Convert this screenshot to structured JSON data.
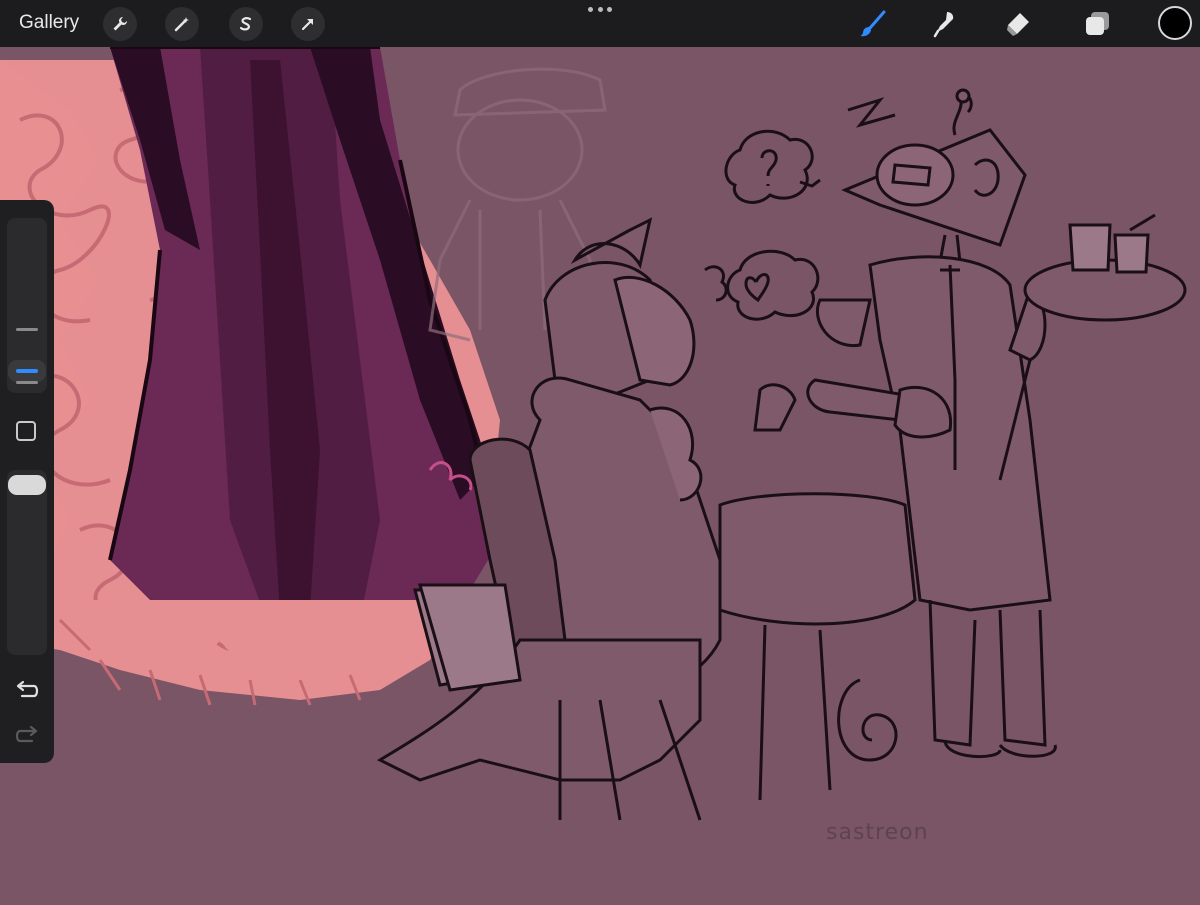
{
  "topbar": {
    "gallery_label": "Gallery",
    "left_tools": [
      "wrench-icon",
      "magic-wand-icon",
      "selection-icon",
      "transform-arrow-icon"
    ],
    "right_tools": [
      "brush-icon",
      "smudge-icon",
      "eraser-icon",
      "layers-icon"
    ],
    "color": "#000000"
  },
  "canvas": {
    "signature": "sastreon",
    "background": "#7a5566"
  },
  "sidebar": {
    "tools": [
      "brush-size-slider",
      "modify-button",
      "opacity-slider",
      "undo-icon",
      "redo-icon"
    ]
  }
}
